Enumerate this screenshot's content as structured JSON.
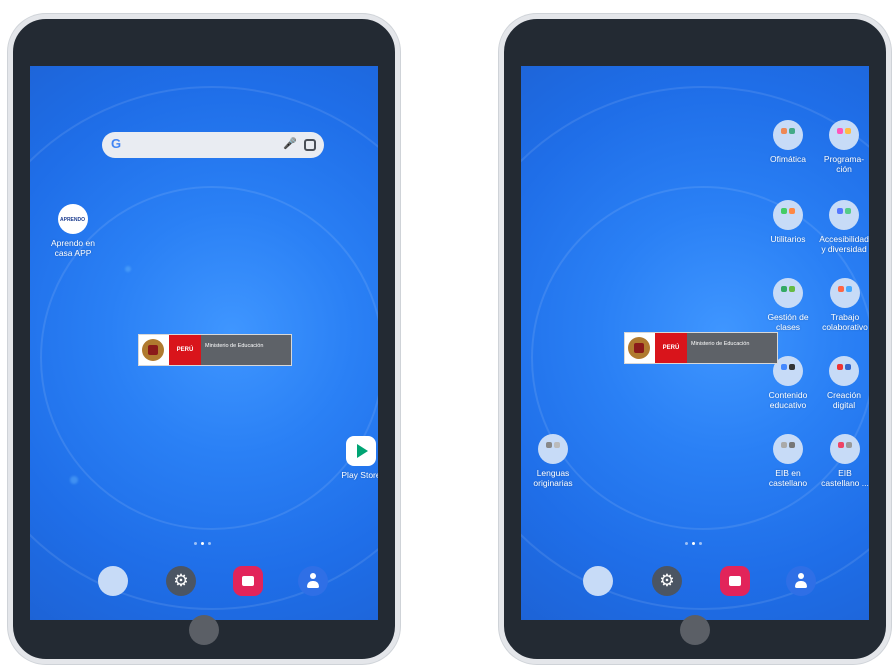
{
  "left_tablet": {
    "apps": {
      "aprendo": {
        "logo_text": "APRENDO",
        "label": "Aprendo en casa APP"
      },
      "play_store": {
        "label": "Play Store"
      }
    },
    "logo": {
      "peru": "PERÚ",
      "ministry": "Ministerio de Educación"
    }
  },
  "right_tablet": {
    "folders": [
      {
        "label": "Ofimática"
      },
      {
        "label": "Programa-ción"
      },
      {
        "label": "Utilitarios"
      },
      {
        "label": "Accesibilidad y diversidad"
      },
      {
        "label": "Gestión de clases"
      },
      {
        "label": "Trabajo colaborativo"
      },
      {
        "label": "Contenido educativo"
      },
      {
        "label": "Creación digital"
      },
      {
        "label": "EIB en castellano"
      },
      {
        "label": "EIB castellano ..."
      }
    ],
    "lenguas": {
      "label": "Lenguas originarias"
    },
    "logo": {
      "peru": "PERÚ",
      "ministry": "Ministerio de Educación"
    }
  },
  "search": {
    "logo": "G"
  },
  "colors": {
    "screen": "#2a80f5",
    "bezel": "#232a33",
    "folder": "#c7dbf7",
    "camera": "#e2245a"
  },
  "icons": [
    "google-icon",
    "mic-icon",
    "lens-icon",
    "settings-gear-icon",
    "camera-icon",
    "contacts-icon",
    "play-store-icon",
    "home-button"
  ]
}
